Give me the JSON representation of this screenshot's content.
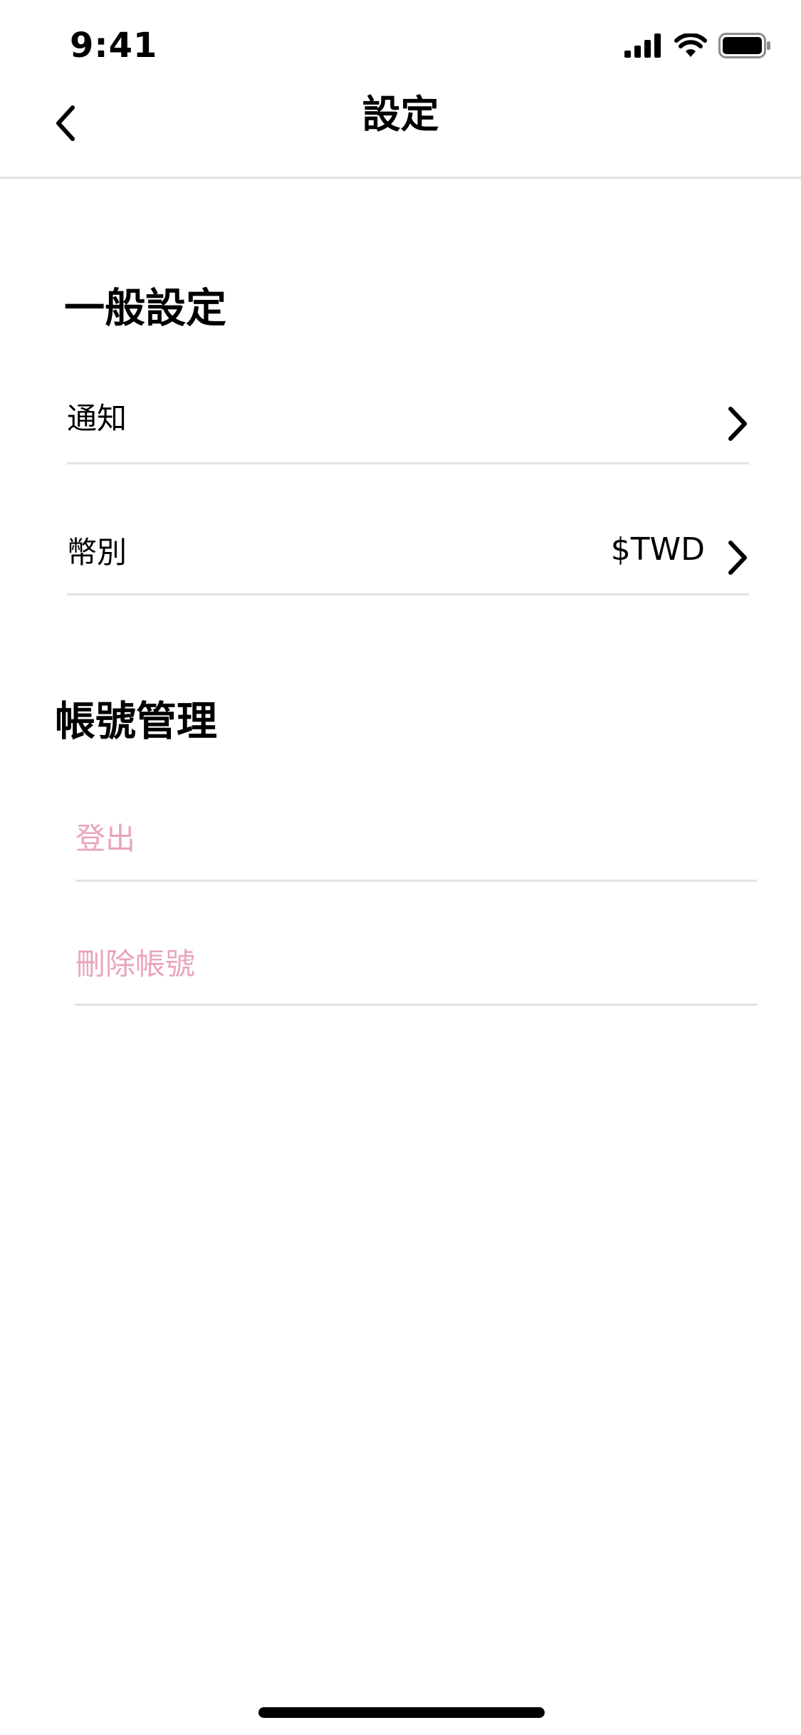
{
  "status_bar": {
    "time": "9:41",
    "icons": [
      "cellular-signal-icon",
      "wifi-icon",
      "battery-icon"
    ]
  },
  "nav": {
    "back_icon": "chevron-left-icon",
    "title": "設定"
  },
  "general_section": {
    "heading": "一般設定",
    "notifications": {
      "label": "通知",
      "icon": "chevron-right-icon"
    },
    "currency": {
      "label": "幣別",
      "value": "$TWD",
      "icon": "chevron-right-icon"
    }
  },
  "account_section": {
    "heading": "帳號管理",
    "logout_label": "登出",
    "delete_account_label": "刪除帳號"
  },
  "colors": {
    "text": "#000000",
    "divider": "#e2e2e2",
    "destructive_text": "#eaa5ba",
    "background": "#ffffff"
  }
}
